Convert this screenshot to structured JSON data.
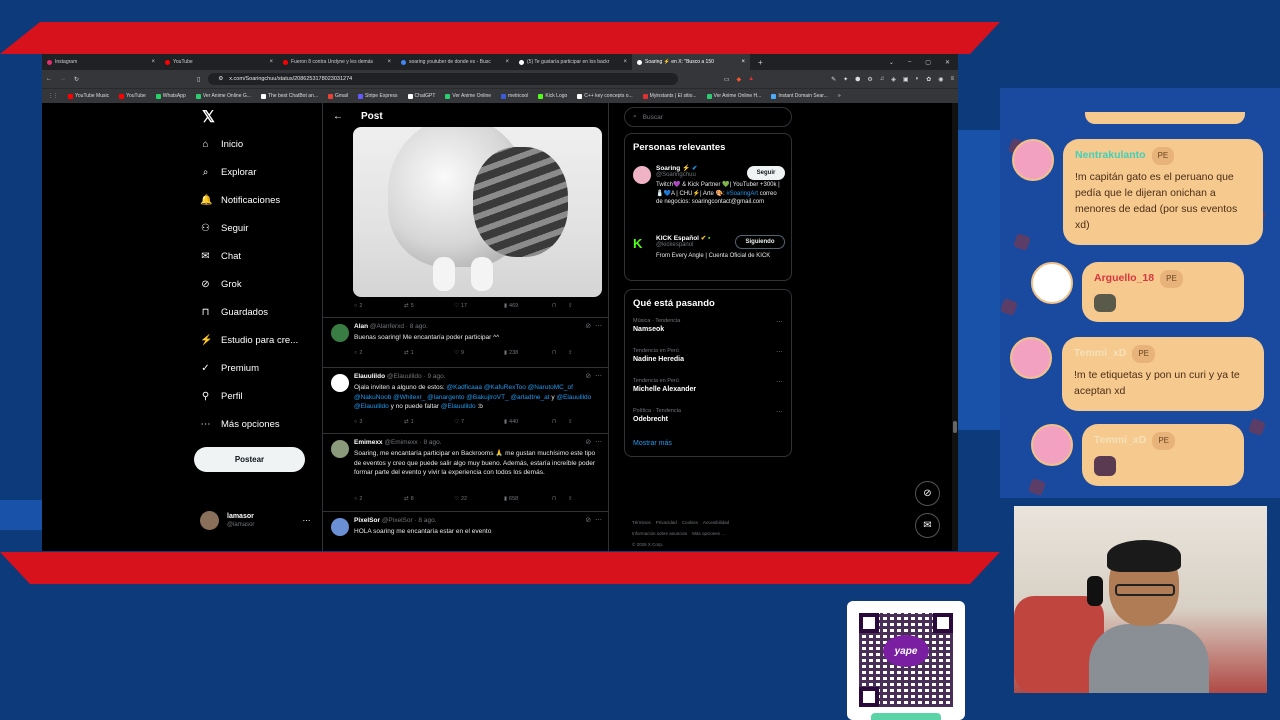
{
  "browser": {
    "tabs": [
      {
        "label": "Instagram",
        "color": "#e1306c"
      },
      {
        "label": "YouTube",
        "color": "#ff0000"
      },
      {
        "label": "Fueron 8 contra Undyne y les demás",
        "color": "#ff0000"
      },
      {
        "label": "soaring youtuber de donde es - Busc",
        "color": "#4285f4"
      },
      {
        "label": "(5) Te gustaría participar en los backr",
        "color": "#ffffff"
      },
      {
        "label": "Soaring ⚡ en X: \"Busco a 150",
        "color": "#ffffff"
      }
    ],
    "new_tab": "+",
    "url": "x.com/Soaringchuu/status/2086253178023031274",
    "bookmarks": [
      {
        "label": "YouTube Music",
        "color": "#ff0000"
      },
      {
        "label": "YouTube",
        "color": "#ff0000"
      },
      {
        "label": "WhatsApp",
        "color": "#25d366"
      },
      {
        "label": "Ver Anime Online G...",
        "color": "#2ecc71"
      },
      {
        "label": "The best ChatBot an...",
        "color": "#ffffff"
      },
      {
        "label": "Gmail",
        "color": "#ea4335"
      },
      {
        "label": "Stripe Express",
        "color": "#635bff"
      },
      {
        "label": "ChatGPT",
        "color": "#ffffff"
      },
      {
        "label": "Ver Anime Online",
        "color": "#2ecc71"
      },
      {
        "label": "metricool",
        "color": "#3b5bdb"
      },
      {
        "label": "Kick Logo",
        "color": "#53fc18"
      },
      {
        "label": "C++ key concepts o...",
        "color": "#ffffff"
      },
      {
        "label": "Myinstants | El sitio...",
        "color": "#e03131"
      },
      {
        "label": "Ver Anime Online H...",
        "color": "#2ecc71"
      },
      {
        "label": "Instant Domain Sear...",
        "color": "#4dabf7"
      }
    ]
  },
  "nav": {
    "items": [
      {
        "label": "Inicio",
        "icon": "home-icon",
        "glyph": "⌂"
      },
      {
        "label": "Explorar",
        "icon": "search-icon",
        "glyph": "⌕"
      },
      {
        "label": "Notificaciones",
        "icon": "bell-icon",
        "glyph": "♫"
      },
      {
        "label": "Seguir",
        "icon": "follow-icon",
        "glyph": "⚇"
      },
      {
        "label": "Chat",
        "icon": "chat-icon",
        "glyph": "✉"
      },
      {
        "label": "Grok",
        "icon": "grok-icon",
        "glyph": "⊘"
      },
      {
        "label": "Guardados",
        "icon": "bookmark-icon",
        "glyph": "⊓"
      },
      {
        "label": "Estudio para cre...",
        "icon": "studio-icon",
        "glyph": "⚡"
      },
      {
        "label": "Premium",
        "icon": "premium-icon",
        "glyph": "✓"
      },
      {
        "label": "Perfil",
        "icon": "profile-icon",
        "glyph": "⚲"
      },
      {
        "label": "Más opciones",
        "icon": "more-icon",
        "glyph": "⋯"
      }
    ],
    "post_button": "Postear",
    "profile_name": "lamasor",
    "profile_handle": "@lamasor"
  },
  "timeline": {
    "header": "Post",
    "main_stats": {
      "replies": "2",
      "reposts": "5",
      "likes": "17",
      "views": "469"
    },
    "tweets": [
      {
        "name": "Alan",
        "handle": "@Alanferxd",
        "time": "· 8 ago.",
        "text": "Buenas soaring! Me encantaría poder participar ^^",
        "replies": "2",
        "reposts": "1",
        "likes": "9",
        "views": "238",
        "avatar": "#3a7d44"
      },
      {
        "name": "Elauulildo",
        "handle": "@Elauulildo",
        "time": "· 9 ago.",
        "text_pre": "Ojala inviten a alguno de estos: ",
        "mentions": "@Kadficaaa @KafuRexToo @NarutoMC_of @NakuNoob @Whitexr_ @lanargento @BakujIroVT_ @arladtne_at",
        "text_mid": " y ",
        "mentions2": "@Elauulildo @Elauulildo",
        "text_mid2": " y no puede faltar ",
        "mentions3": "@Elauulildo",
        "text_end": " :b",
        "replies": "3",
        "reposts": "1",
        "likes": "7",
        "views": "440",
        "avatar": "#ffffff"
      },
      {
        "name": "Emimexx",
        "handle": "@Emimexx",
        "time": "· 8 ago.",
        "text": "Soaring, me encantaría participar en Backrooms 🙏 me gustan muchísimo este tipo de eventos y creo que puede salir algo muy bueno. Además, estaría increíble poder formar parte del evento y vivir la experiencia con todos los demás.",
        "replies": "2",
        "reposts": "8",
        "likes": "22",
        "views": "658",
        "avatar": "#8a9a7a"
      },
      {
        "name": "PixelSor",
        "handle": "@PixelSor",
        "time": "· 8 ago.",
        "text": "HOLA soaring me encantaría estar en el evento",
        "avatar": "#6b8fd4"
      }
    ]
  },
  "sidebar": {
    "search_placeholder": "Buscar",
    "relevant_title": "Personas relevantes",
    "people": [
      {
        "name": "Soaring ⚡",
        "handle": "@Soaringchuu",
        "bio_pre": "Twitch💜 & Kick Partner 💚| YouTuber +300k | 🧂💙A | CHU⚡| Arte 🎨: ",
        "bio_link": "#SoaringArt",
        "bio_post": " correo de negocios: soaringcontact@gmail.com",
        "button": "Seguir"
      },
      {
        "name": "KICK Español",
        "handle": "@kickespanol",
        "bio": "From Every Angle | Cuenta Oficial de KICK",
        "button": "Siguiendo"
      }
    ],
    "trending_title": "Qué está pasando",
    "trends": [
      {
        "category": "Música · Tendencia",
        "name": "Namseok"
      },
      {
        "category": "Tendencia en Perú",
        "name": "Nadine Heredia"
      },
      {
        "category": "Tendencia en Perú",
        "name": "Michelle Alexander"
      },
      {
        "category": "Política · Tendencia",
        "name": "Odebrecht"
      }
    ],
    "show_more": "Mostrar más",
    "footer": [
      "Términos",
      "Privacidad",
      "Cookies",
      "Accesibilidad",
      "Información sobre anuncios",
      "Más opciones ...",
      "© 2026 X Corp."
    ]
  },
  "chat": {
    "messages": [
      {
        "user": "Nentrakulanto",
        "badge": "PE",
        "text": "!m capitán gato es el peruano que pedía que le dijeran onichan a menores de edad (por sus eventos xd)"
      },
      {
        "user": "Arguello_18",
        "badge": "PE",
        "text": ""
      },
      {
        "user": "Temmi_xD",
        "badge": "PE",
        "text": "!m te etiquetas y pon un curi y ya te aceptan xd"
      },
      {
        "user": "Temmi_xD",
        "badge": "PE",
        "text": ""
      }
    ]
  },
  "qr": {
    "brand": "yape"
  }
}
